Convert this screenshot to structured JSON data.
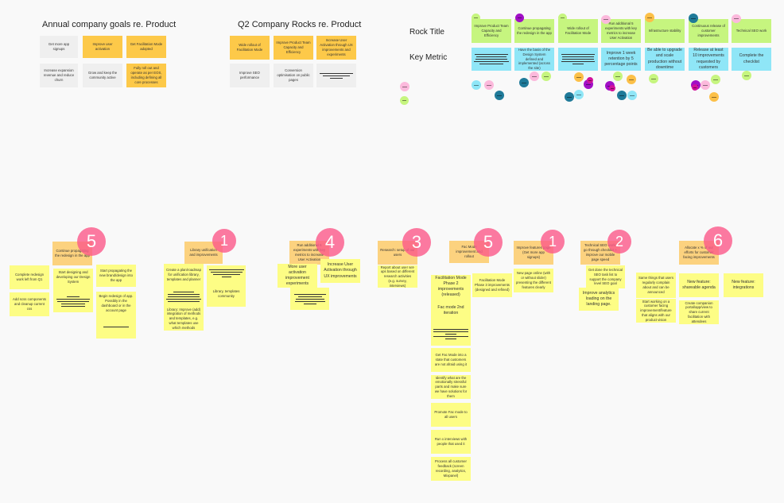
{
  "goals": {
    "title": "Annual company goals re. Product",
    "cards": [
      {
        "text": "Get more app signups",
        "color": "gray"
      },
      {
        "text": "Improve user activation",
        "color": "orange"
      },
      {
        "text": "Get Facilitation Mode adopted",
        "color": "orange"
      },
      {
        "text": "Increase expansion revenue and reduce churn",
        "color": "gray"
      },
      {
        "text": "Grow and keep the community active",
        "color": "gray"
      },
      {
        "text": "Fully roll out and operate as per EOS, including defining all core processes",
        "color": "orange"
      }
    ]
  },
  "rocks": {
    "title": "Q2 Company Rocks re. Product",
    "cards": [
      {
        "text": "Wide rollout of Facilitation Mode",
        "color": "orange"
      },
      {
        "text": "Improve Product Team Capacity and Efficiency",
        "color": "orange"
      },
      {
        "text": "Increase User Activation through UX improvements and experiments",
        "color": "orange"
      },
      {
        "text": "Improve SEO performance",
        "color": "gray"
      },
      {
        "text": "Conversion optimisation on public pages",
        "color": "gray"
      },
      {
        "text": "",
        "color": "gray"
      }
    ]
  },
  "matrix": {
    "row_labels": {
      "title": "Rock Title",
      "metric": "Key Metric"
    },
    "columns": [
      {
        "title": "Improve Product Team Capacity and Efficiency",
        "metric": ""
      },
      {
        "title": "Continue propagating the redesign in the app",
        "metric": "Have the basis of the Design System defined and implemented (across the site)"
      },
      {
        "title": "Wide rollout of Facilitation Mode",
        "metric": ""
      },
      {
        "title": "Run additional 5 experiments with key metrics to increase User Activation",
        "metric": "Improve 1 week retention by 5 percentage points"
      },
      {
        "title": "Infrastructure stability",
        "metric": "Be able to upgrade and scale production without downtime"
      },
      {
        "title": "Continuous release of customer improvements",
        "metric": "Release at least 10 improvements requested by customers"
      },
      {
        "title": "Technical SEO work",
        "metric": "Complete the checklist"
      }
    ]
  },
  "clusters": [
    {
      "vote": "5",
      "header": "Continue propagating the redesign in the app",
      "notes": [
        "Complete redesign work left from Q1",
        "Add scss components and cleanup current css",
        "Start designing and developing our Design System",
        "Start propagating the new brand/design into the app",
        "Begin redesign of app. Possibly in the dashboard or in the account page"
      ]
    },
    {
      "vote": "1",
      "header": "Library unification and improvements",
      "notes": [
        "Create a plan/roadmap for unification library, templates and planner",
        "Library: Improve (add) integration of methods and templates, e.g. what templates use which methods",
        "Library, templates community"
      ]
    },
    {
      "vote": "4",
      "header": "Run additional 5 experiments with key metrics to increase User Activation",
      "notes": [
        "More user activation improvement experiments",
        "Increase User Activation through UX improvements"
      ]
    },
    {
      "vote": "3",
      "header": "Research: setup of our users",
      "notes": [
        "Report about user set-ups based on different research activities (e.g. survey, interviews)"
      ]
    },
    {
      "vote": "5",
      "header": "Fac Mode improvement and rollout",
      "notes": [
        "Facilitation Mode Phase 2 improvements (released)",
        "Fac mode 2nd iteration",
        "Facilitation Mode Phase 3 improvements (designed and refined)",
        "Get Fac Mode into a state that customers are not afraid using it",
        "Identify what are the emotionally stressful parts and make sure we have solutions for them",
        "Promote Fac mode to all users",
        "Run x interviews with people that used it",
        "Process all customer feedback (screen recording, analytics, Mixpanel)"
      ]
    },
    {
      "vote": "1",
      "header": "Improve features page (Get more app signups)",
      "notes": [
        "New page online (with or without slider) presenting the different features clearly"
      ]
    },
    {
      "vote": "2",
      "header": "Technical SEO work: go through checklist + improve our mobile page speed",
      "notes": [
        "Get done the technical SEO task list to support the company level SEO goal",
        "Improve analytics loading on the landing page."
      ]
    },
    {
      "vote": "6",
      "header": "Allocate x % of our efforts for customer facing improvements",
      "notes": [
        "Same things that users regularly complain about and can be announced",
        "Start working on a customer facing improvement/feature that aligns with our product vision",
        "New feature: shareable agenda",
        "Create companion portal/app/view to share current facilitation with attendees",
        "New feature: integrations"
      ]
    }
  ],
  "colors": {
    "background": "#f9f9f9",
    "goal_gray": "#efefef",
    "goal_orange": "#fdc949",
    "title_green": "#c6f57f",
    "metric_blue": "#8fe6f7",
    "header_peach": "#fcd27f",
    "note_yellow": "#fdfd85",
    "vote_pink": "#fb598a",
    "dot_pink": "#fcb9dc",
    "dot_green": "#c6f57f",
    "dot_blue": "#8fe6f7",
    "dot_teal": "#1f7a99",
    "dot_purple": "#a10fc6",
    "dot_magenta": "#d1129b",
    "dot_orange": "#fcc048"
  }
}
